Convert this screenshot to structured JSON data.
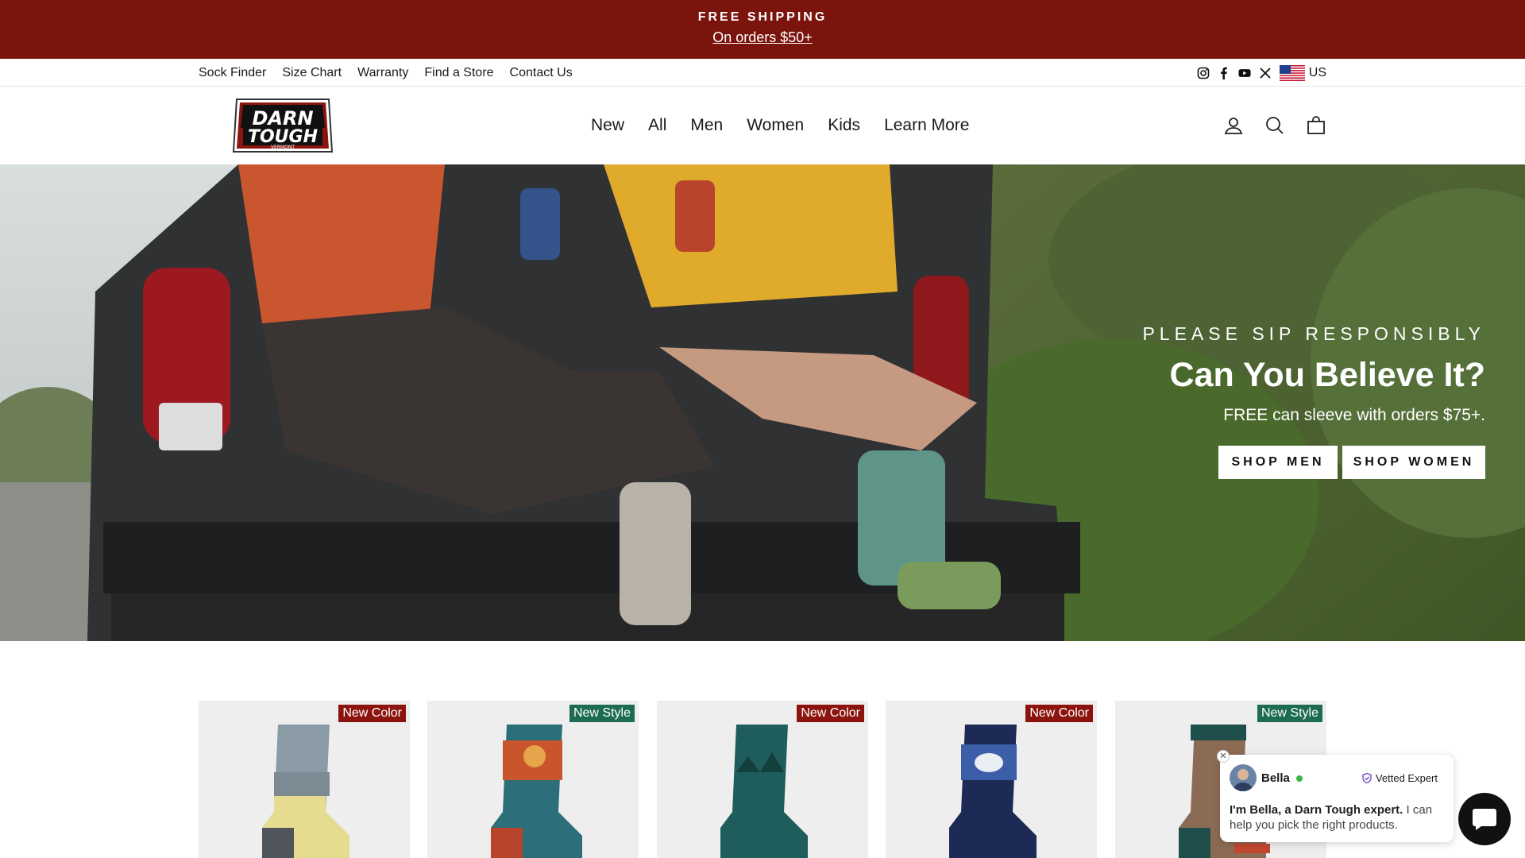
{
  "announcement": {
    "title": "FREE SHIPPING",
    "link": "On orders $50+"
  },
  "utility": {
    "links": [
      "Sock Finder",
      "Size Chart",
      "Warranty",
      "Find a Store",
      "Contact Us"
    ],
    "country": "US",
    "social_icons": [
      "instagram-icon",
      "facebook-icon",
      "youtube-icon",
      "x-icon"
    ]
  },
  "header": {
    "logo": {
      "line1": "DARN",
      "line2": "TOUGH",
      "line3": "VERMONT"
    },
    "nav": [
      "New",
      "All",
      "Men",
      "Women",
      "Kids",
      "Learn More"
    ],
    "icons": [
      "account-icon",
      "search-icon",
      "cart-icon"
    ]
  },
  "hero": {
    "kicker": "PLEASE SIP RESPONSIBLY",
    "title": "Can You Believe It?",
    "subtitle": "FREE can sleeve with orders $75+.",
    "buttons": {
      "men": "SHOP MEN",
      "women": "SHOP WOMEN"
    }
  },
  "products": [
    {
      "badge": "New Color",
      "badge_color": "#8c140e"
    },
    {
      "badge": "New Style",
      "badge_color": "#1d6b52"
    },
    {
      "badge": "New Color",
      "badge_color": "#8c140e"
    },
    {
      "badge": "New Color",
      "badge_color": "#8c140e"
    },
    {
      "badge": "New Style",
      "badge_color": "#1d6b52"
    }
  ],
  "chat": {
    "name": "Bella",
    "status": "Vetted Expert",
    "message_bold": "I'm Bella, a Darn Tough expert.",
    "message_rest": " I can help you pick the right products.",
    "close": "✕"
  },
  "colors": {
    "announcement_bg": "#7a140c",
    "badge_new_color": "#8c140e",
    "badge_new_style": "#1d6b52"
  }
}
